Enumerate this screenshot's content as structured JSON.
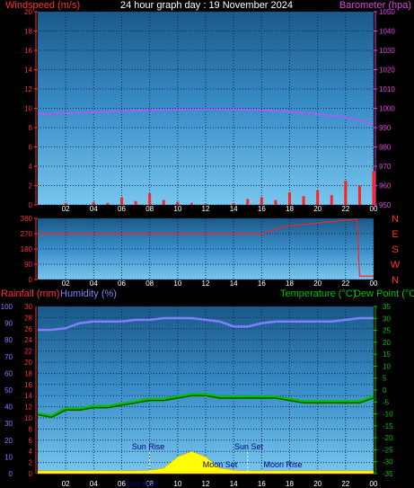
{
  "header": {
    "title": "24 hour graph day : 19 November 2024",
    "left_label": "Windspeed (m/s)",
    "right_label": "Barometer (hpa)"
  },
  "colors": {
    "wind_label": "#ff3030",
    "baro_label": "#e040e0",
    "baro_line": "#c050ff",
    "wind_fill": "#ff2020",
    "gust": "#00b000",
    "direction": "#ff2020",
    "temperature": "#00c000",
    "humidity": "#8080ff",
    "rain_axis": "#ff3030",
    "sun": "#ffff00",
    "moon_label": "#000080"
  },
  "time_ticks": [
    "02",
    "04",
    "06",
    "08",
    "10",
    "12",
    "14",
    "16",
    "18",
    "20",
    "22",
    "00"
  ],
  "chart_data": [
    {
      "type": "area",
      "title": "Windspeed (m/s) / Barometer (hpa)",
      "left_axis": {
        "label": "Windspeed (m/s)",
        "ticks": [
          0,
          2,
          4,
          6,
          8,
          10,
          12,
          14,
          16,
          18,
          20
        ],
        "ylim": [
          0,
          20
        ]
      },
      "right_axis": {
        "label": "Barometer (hpa)",
        "ticks": [
          950,
          960,
          970,
          980,
          990,
          1000,
          1010,
          1020,
          1030,
          1040,
          1050
        ],
        "ylim": [
          950,
          1050
        ]
      },
      "x_hours": [
        0,
        2,
        4,
        6,
        8,
        10,
        12,
        14,
        16,
        18,
        20,
        22,
        24
      ],
      "series": [
        {
          "name": "Barometer (hpa)",
          "axis": "right",
          "values": [
            997,
            997.5,
            998,
            998.5,
            999,
            999.3,
            999.5,
            999.4,
            999,
            998.3,
            997,
            995.5,
            992
          ]
        },
        {
          "name": "Windspeed (m/s)",
          "axis": "left",
          "values": [
            0,
            0,
            0.2,
            0,
            0.3,
            0.2,
            0.8,
            0.4,
            1.2,
            0.5,
            0.3,
            0.2,
            0.1,
            0,
            0.2,
            0.6,
            0.8,
            0.5,
            1.3,
            0.9,
            1.5,
            1,
            2.5,
            2,
            3.5
          ]
        }
      ]
    },
    {
      "type": "line",
      "title": "Wind direction",
      "left_axis": {
        "ticks": [
          0,
          90,
          180,
          270,
          360
        ],
        "ylim": [
          0,
          360
        ]
      },
      "right_axis": {
        "ticks": [
          "N",
          "W",
          "S",
          "E",
          "N"
        ]
      },
      "x_hours": [
        0,
        16,
        16.5,
        17.5,
        18,
        21.5,
        22,
        22.8,
        23,
        24
      ],
      "values": [
        270,
        270,
        280,
        310,
        315,
        345,
        350,
        355,
        20,
        20
      ]
    },
    {
      "type": "line",
      "title": "Rainfall / Humidity / Temperature / Dew Point",
      "left_labels": {
        "rain": "Rainfall (mm)",
        "humidity": "Humidity (%)"
      },
      "right_labels": {
        "temperature": "Temperature (°C)",
        "dew": "Dew Point (°C)"
      },
      "humidity_axis": {
        "ticks": [
          0,
          10,
          20,
          30,
          40,
          50,
          60,
          70,
          80,
          90,
          100
        ],
        "ylim": [
          0,
          100
        ]
      },
      "rain_axis": {
        "ticks": [
          0,
          2,
          4,
          6,
          8,
          10,
          12,
          14,
          16,
          18,
          20,
          22,
          24,
          26,
          28,
          30
        ],
        "ylim": [
          0,
          30
        ]
      },
      "temp_axis": {
        "ticks": [
          -35,
          -30,
          -25,
          -20,
          -15,
          -10,
          -5,
          0,
          5,
          10,
          15,
          20,
          25,
          30,
          35
        ],
        "ylim": [
          -35,
          35
        ]
      },
      "x_hours": [
        0,
        1,
        2,
        3,
        4,
        5,
        6,
        7,
        8,
        9,
        10,
        11,
        12,
        13,
        14,
        15,
        16,
        17,
        18,
        19,
        20,
        21,
        22,
        23,
        24
      ],
      "series": [
        {
          "name": "Humidity (%)",
          "values": [
            86,
            86,
            87,
            90,
            91,
            91,
            91,
            92,
            92,
            93,
            93,
            93,
            92,
            91,
            88,
            88,
            90,
            91,
            91,
            91,
            91,
            91,
            92,
            93,
            93
          ]
        },
        {
          "name": "Temperature (°C)",
          "values": [
            -10,
            -11,
            -8,
            -8,
            -7,
            -7,
            -6,
            -5,
            -4,
            -4,
            -3,
            -2,
            -2,
            -3,
            -3,
            -3,
            -3,
            -3,
            -4,
            -5,
            -5,
            -5,
            -5,
            -5,
            -3
          ]
        },
        {
          "name": "Rainfall (mm)",
          "values": [
            0.5,
            0.5,
            0.5,
            0.5,
            0.5,
            0.5,
            0.5,
            0.5,
            0.6,
            1,
            3,
            4,
            3,
            1,
            0.6,
            0.5,
            0.5,
            0.5,
            0.5,
            0.5,
            0.5,
            0.5,
            0.5,
            0.5,
            0.5
          ]
        }
      ],
      "annotations": {
        "sun_rise": "Sun Rise",
        "sun_set": "Sun Set",
        "moon_set": "Moon Set",
        "moon_rise": "Moon Rise",
        "sun_x_label": "Sun Rise"
      }
    }
  ]
}
